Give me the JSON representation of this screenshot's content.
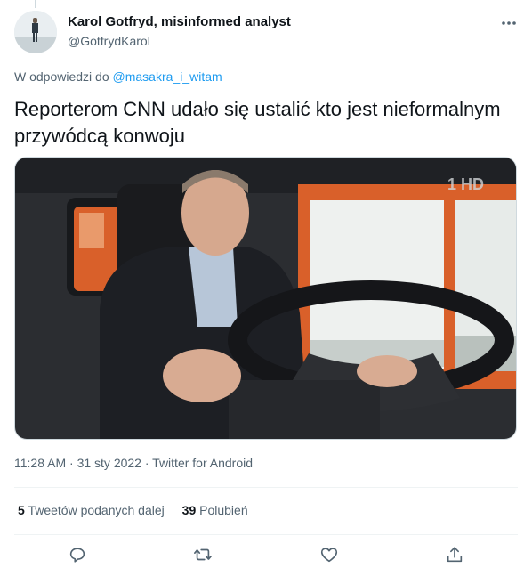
{
  "tweet": {
    "author_name": "Karol Gotfryd, misinformed analyst",
    "author_handle": "@GotfrydKarol",
    "reply_prefix": "W odpowiedzi do",
    "reply_mention": "@masakra_i_witam",
    "text": "Reporterom CNN udało się ustalić kto jest nieformalnym przywódcą konwoju",
    "media_watermark": "1 HD",
    "time": "11:28 AM",
    "date": "31 sty 2022",
    "source": "Twitter for Android",
    "sep": "·"
  },
  "stats": {
    "retweets_count": "5",
    "retweets_label": "Tweetów podanych dalej",
    "likes_count": "39",
    "likes_label": "Polubień"
  },
  "icons": {
    "more": "more-horizontal-icon",
    "reply": "reply-bubble-icon",
    "retweet": "retweet-icon",
    "like": "heart-icon",
    "share": "share-upload-icon"
  },
  "colors": {
    "link": "#1d9bf0",
    "secondary_text": "#536471",
    "divider": "#eff3f4",
    "truck_orange": "#d9602a"
  }
}
